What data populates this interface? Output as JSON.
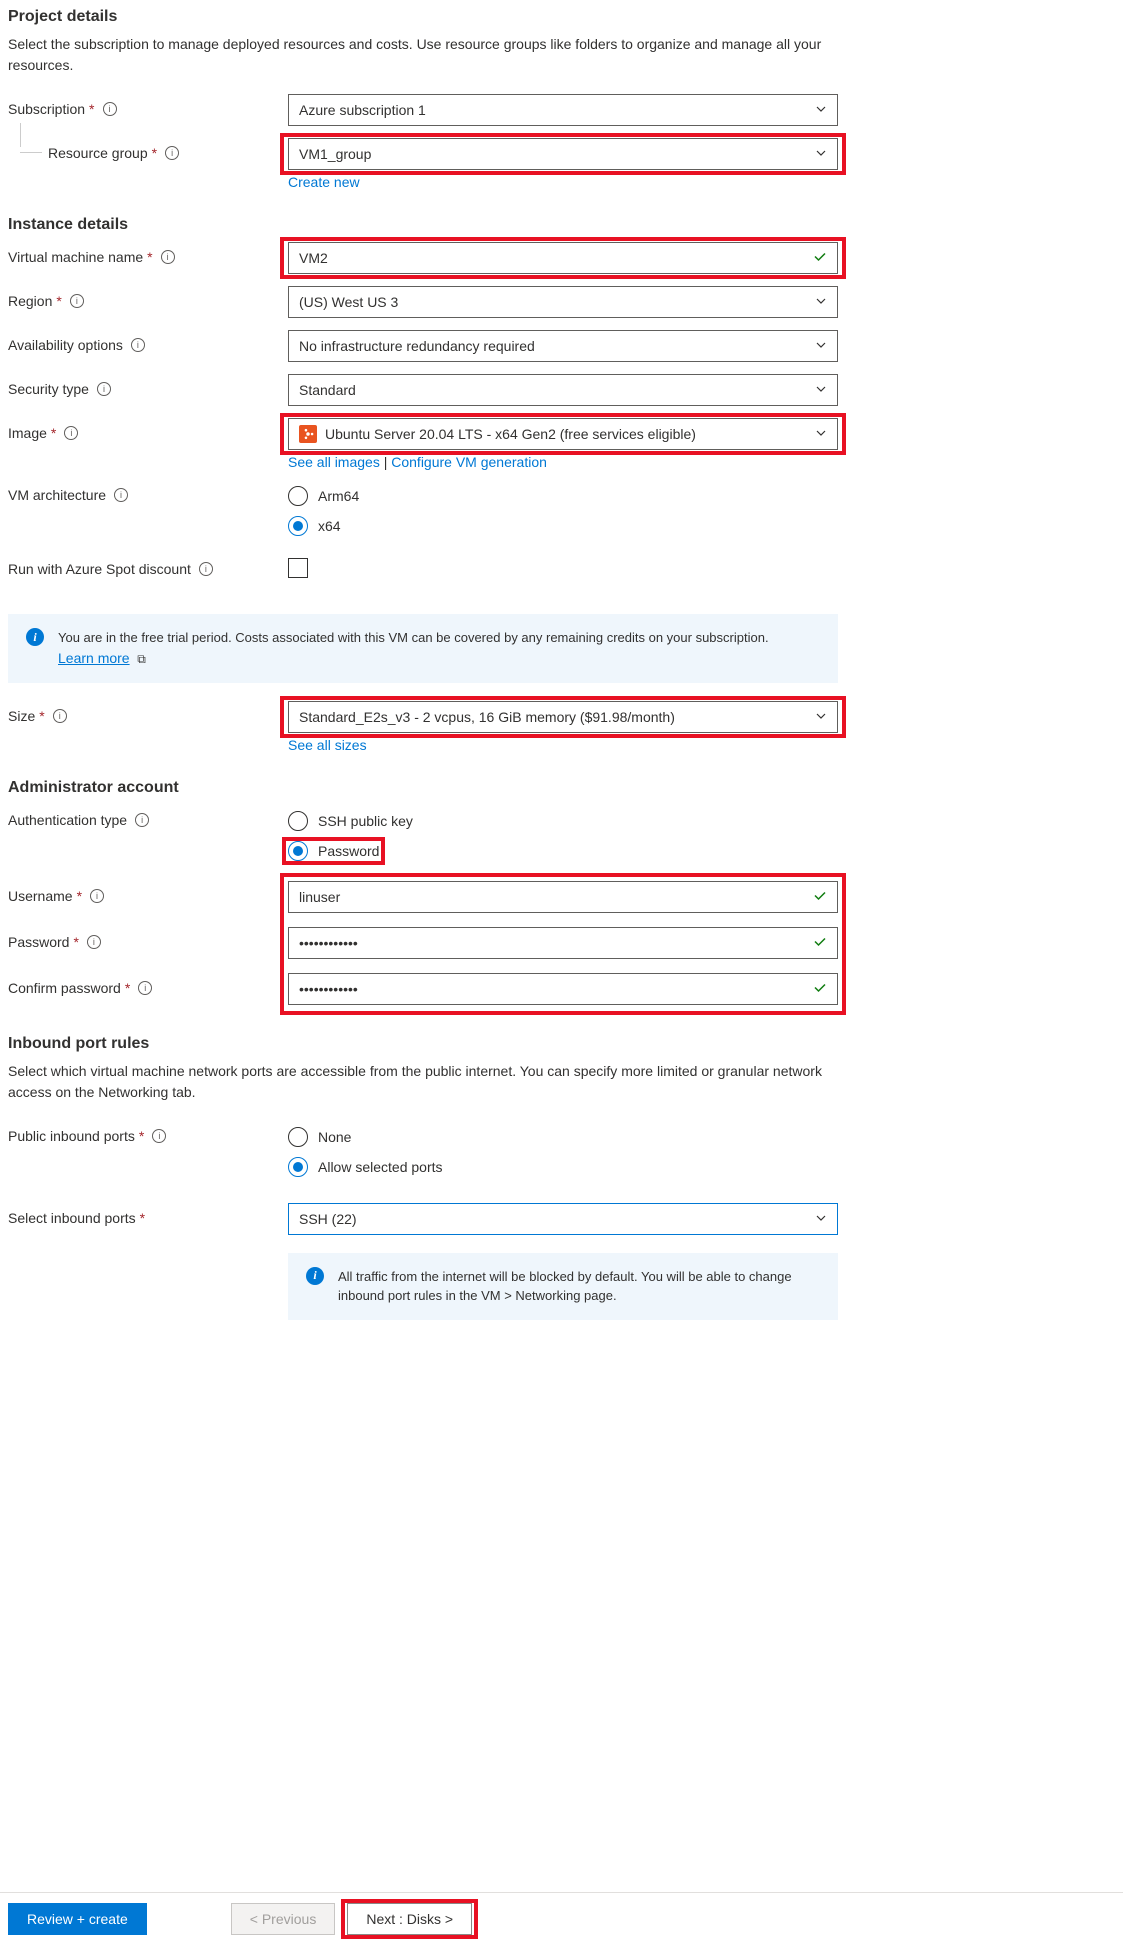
{
  "projectDetails": {
    "heading": "Project details",
    "description": "Select the subscription to manage deployed resources and costs. Use resource groups like folders to organize and manage all your resources.",
    "subscription": {
      "label": "Subscription",
      "value": "Azure subscription 1"
    },
    "resourceGroup": {
      "label": "Resource group",
      "value": "VM1_group",
      "createNew": "Create new"
    }
  },
  "instanceDetails": {
    "heading": "Instance details",
    "vmName": {
      "label": "Virtual machine name",
      "value": "VM2"
    },
    "region": {
      "label": "Region",
      "value": "(US) West US 3"
    },
    "availability": {
      "label": "Availability options",
      "value": "No infrastructure redundancy required"
    },
    "securityType": {
      "label": "Security type",
      "value": "Standard"
    },
    "image": {
      "label": "Image",
      "value": "Ubuntu Server 20.04 LTS - x64 Gen2 (free services eligible)",
      "seeAll": "See all images",
      "configure": "Configure VM generation"
    },
    "vmArch": {
      "label": "VM architecture",
      "options": {
        "arm64": "Arm64",
        "x64": "x64"
      },
      "selected": "x64"
    },
    "spotDiscount": {
      "label": "Run with Azure Spot discount",
      "checked": false
    }
  },
  "freeTrialBanner": {
    "text": "You are in the free trial period. Costs associated with this VM can be covered by any remaining credits on your subscription.",
    "learnMore": "Learn more"
  },
  "size": {
    "label": "Size",
    "value": "Standard_E2s_v3 - 2 vcpus, 16 GiB memory ($91.98/month)",
    "seeAll": "See all sizes"
  },
  "adminAccount": {
    "heading": "Administrator account",
    "authType": {
      "label": "Authentication type",
      "options": {
        "ssh": "SSH public key",
        "password": "Password"
      },
      "selected": "password"
    },
    "username": {
      "label": "Username",
      "value": "linuser"
    },
    "password": {
      "label": "Password",
      "value": "••••••••••••"
    },
    "confirmPassword": {
      "label": "Confirm password",
      "value": "••••••••••••"
    }
  },
  "inboundPortRules": {
    "heading": "Inbound port rules",
    "description": "Select which virtual machine network ports are accessible from the public internet. You can specify more limited or granular network access on the Networking tab.",
    "publicPorts": {
      "label": "Public inbound ports",
      "options": {
        "none": "None",
        "allow": "Allow selected ports"
      },
      "selected": "allow"
    },
    "selectPorts": {
      "label": "Select inbound ports",
      "value": "SSH (22)"
    },
    "infoBanner": "All traffic from the internet will be blocked by default. You will be able to change inbound port rules in the VM > Networking page."
  },
  "footer": {
    "reviewCreate": "Review + create",
    "previous": "< Previous",
    "next": "Next : Disks >"
  }
}
